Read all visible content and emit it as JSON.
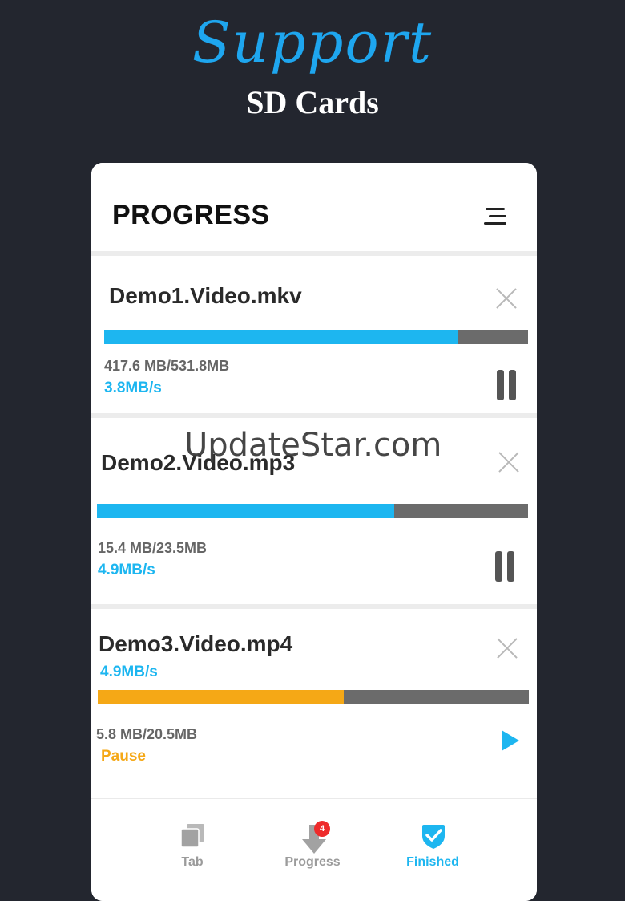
{
  "promo": {
    "headline": "Support",
    "subheadline": "SD Cards"
  },
  "app": {
    "title": "PROGRESS"
  },
  "downloads": [
    {
      "name": "Demo1.Video.mkv",
      "size": "417.6 MB/531.8MB",
      "speed": "3.8MB/s",
      "progress": 0.836,
      "state": "downloading",
      "action_icon": "pause-icon"
    },
    {
      "name": "Demo2.Video.mp3",
      "size": "15.4 MB/23.5MB",
      "speed": "4.9MB/s",
      "progress": 0.69,
      "state": "downloading",
      "action_icon": "pause-icon"
    },
    {
      "name": "Demo3.Video.mp4",
      "size": "5.8 MB/20.5MB",
      "speed": "4.9MB/s",
      "status": "Pause",
      "progress": 0.57,
      "state": "paused",
      "action_icon": "play-icon"
    }
  ],
  "watermark": "UpdateStar.com",
  "bottom_nav": {
    "items": [
      {
        "label": "Tab",
        "icon": "tabs-icon",
        "active": false
      },
      {
        "label": "Progress",
        "icon": "download-icon",
        "active": false,
        "badge": "4"
      },
      {
        "label": "Finished",
        "icon": "check-shield-icon",
        "active": true
      }
    ]
  },
  "colors": {
    "background": "#23262f",
    "accent": "#1db6f0",
    "paused": "#f5a816",
    "track": "#6b6b6b"
  }
}
